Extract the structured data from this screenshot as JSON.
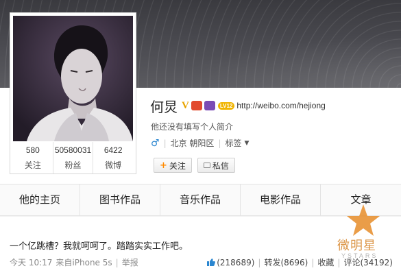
{
  "profile": {
    "name": "何炅",
    "verified_badge": "V",
    "level_badge": "LV12",
    "url": "http://weibo.com/hejiong",
    "intro": "他还没有填写个人简介",
    "gender_symbol": "♂",
    "location": "北京 朝阳区",
    "tags_label": "标签",
    "caret": "▼"
  },
  "stats": [
    {
      "value": "580",
      "label": "关注"
    },
    {
      "value": "50580031",
      "label": "粉丝"
    },
    {
      "value": "6422",
      "label": "微博"
    }
  ],
  "buttons": {
    "follow_plus": "+",
    "follow": "关注",
    "message": "私信"
  },
  "tabs": [
    "他的主页",
    "图书作品",
    "音乐作品",
    "电影作品",
    "文章"
  ],
  "post": {
    "text": "一个亿跳槽？我就呵呵了。踏踏实实工作吧。",
    "time": "今天 10:17",
    "source_prefix": "来自",
    "source": "iPhone 5s",
    "report": "举报",
    "likes": "(218689)",
    "repost": "转发(8696)",
    "favorite": "收藏",
    "comment": "评论(34192)"
  },
  "watermark": {
    "text": "微明星",
    "sub": "YSTARS"
  },
  "icons": {
    "gender": "male-icon",
    "thumb": "thumbs-up-icon",
    "message": "envelope-icon",
    "star": "star-logo-icon"
  },
  "colors": {
    "accent_orange": "#ff8a00",
    "gender_blue": "#2a86d0",
    "verified_gold": "#e8a400"
  }
}
